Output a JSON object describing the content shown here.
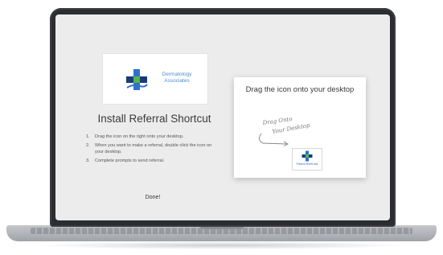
{
  "colors": {
    "brand_blue": "#2f6fd0",
    "brand_navy": "#1a3a7a",
    "brand_green": "#4fb848",
    "hand_ink": "#777777"
  },
  "logo": {
    "name_line1": "Dermatology",
    "name_line2": "Associates",
    "icon": "medical-cross-icon"
  },
  "page": {
    "title": "Install Referral Shortcut",
    "steps": [
      {
        "num": "1.",
        "text": "Drag the icon on the right onto your desktop."
      },
      {
        "num": "2.",
        "text": "When you want to make a referral, double click the icon on your desktop."
      },
      {
        "num": "3.",
        "text": "Complete prompts to send referral."
      }
    ],
    "done_label": "Done!"
  },
  "drag_card": {
    "title": "Drag the icon onto your desktop",
    "handwriting_line1": "Drag Onto",
    "handwriting_line2": "Your Desktop",
    "shortcut_label": "Patient Referrals",
    "shortcut_icon": "medical-cross-icon"
  }
}
